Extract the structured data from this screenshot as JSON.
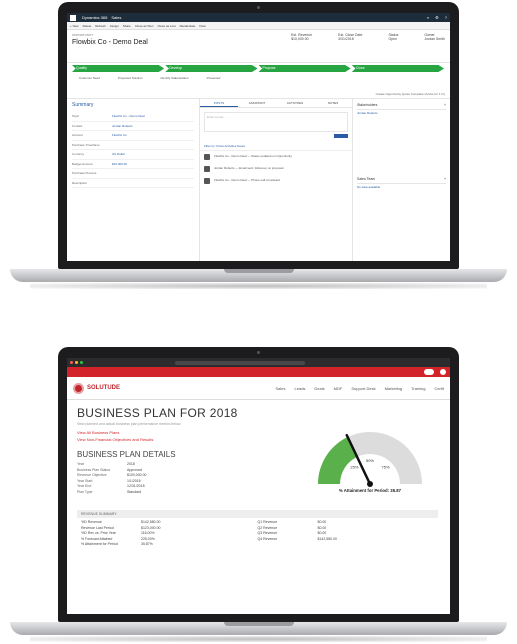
{
  "laptop1": {
    "app_title": "Dynamics 365",
    "nav": "Sales",
    "command_bar": [
      "+ New",
      "Delete",
      "Refresh",
      "Assign",
      "Share",
      "Close as Won",
      "Close as Lost",
      "Recalculate",
      "Flow"
    ],
    "record_type": "OPPORTUNITY",
    "record_title": "Flowbix Co - Demo Deal",
    "header_stats": [
      "Est. Revenue",
      "Est. Close Date",
      "Status",
      "Owner"
    ],
    "header_values": [
      "$10,000.00",
      "3/31/2018",
      "Open",
      "Jordan Smith"
    ],
    "stages": [
      "Qualify",
      "Develop",
      "Propose",
      "Close"
    ],
    "fields_row": [
      "Customer Need",
      "Proposed Solution",
      "Identify Stakeholders",
      "Presented"
    ],
    "status_line": "Create Opportunity Quote Complete (Active for 1 hr)",
    "summary_header": "Summary",
    "form": [
      {
        "label": "Topic",
        "value": "Flowbix Co - Demo Deal"
      },
      {
        "label": "Contact",
        "value": "Jordan Roberts"
      },
      {
        "label": "Account",
        "value": "Flowbix Co"
      },
      {
        "label": "Purchase Timeframe",
        "value": ""
      },
      {
        "label": "Currency",
        "value": "US Dollar"
      },
      {
        "label": "Budget Amount",
        "value": "$10,000.00"
      },
      {
        "label": "Purchase Process",
        "value": ""
      },
      {
        "label": "Description",
        "value": ""
      }
    ],
    "tabs": [
      "POSTS",
      "ASSISTANT",
      "ACTIVITIES",
      "NOTES"
    ],
    "note_placeholder": "Enter a note...",
    "filters": "Filter by: Posts  Activities  Notes",
    "activities": [
      "Flowbix Co - Demo Deal — Status updated on Opportunity",
      "Jordan Roberts — Email sent: follow-up on proposal",
      "Flowbix Co - Demo Deal — Phone call completed"
    ],
    "side_panels": [
      {
        "title": "Stakeholders",
        "rows": [
          "Jordan Roberts"
        ]
      },
      {
        "title": "Sales Team",
        "rows": [
          "No data available"
        ]
      }
    ]
  },
  "laptop2": {
    "brand": "SOLUTUDE",
    "menu": [
      "Sales",
      "Leads",
      "Deals",
      "MDF",
      "Support Desk",
      "Marketing",
      "Training",
      "Certif"
    ],
    "page_title": "BUSINESS PLAN FOR 2018",
    "subtitle": "View planned and actual business plan performance metrics below.",
    "links": [
      "View All Business Plans",
      "View Non-Financial Objectives and Results"
    ],
    "details_title": "BUSINESS PLAN DETAILS",
    "details": [
      {
        "k": "Year",
        "v": "2018"
      },
      {
        "k": "Business Plan Status",
        "v": "Approved"
      },
      {
        "k": "Revenue Objective",
        "v": "$100,000.00"
      },
      {
        "k": "Year Start",
        "v": "1/1/2018"
      },
      {
        "k": "Year End",
        "v": "12/31/2018"
      },
      {
        "k": "Plan Type",
        "v": "Standard"
      }
    ],
    "gauge_value": 35.87,
    "gauge_ticks": [
      "25%",
      "50%",
      "75%"
    ],
    "gauge_label": "% Attainment for Period: 35.87",
    "revenue_title": "REVENUE SUMMARY",
    "revenue_left": [
      {
        "k": "YtD Revenue",
        "v": "$142,580.00"
      },
      {
        "k": "Revenue Last Period",
        "v": "$123,000.00"
      },
      {
        "k": "YtD Rev vs. Prior Year",
        "v": "116.00%"
      },
      {
        "k": "% Forecast Attained",
        "v": "225.00%"
      },
      {
        "k": "% Attainment for Period",
        "v": "35.87%"
      }
    ],
    "revenue_right": [
      {
        "k": "Q1 Revenue",
        "v": "$0.00"
      },
      {
        "k": "Q2 Revenue",
        "v": "$0.00"
      },
      {
        "k": "Q3 Revenue",
        "v": "$0.00"
      },
      {
        "k": "Q4 Revenue",
        "v": "$142,580.00"
      }
    ],
    "colors": {
      "brand_red": "#d2232a",
      "gauge_green": "#5ab14b"
    }
  }
}
